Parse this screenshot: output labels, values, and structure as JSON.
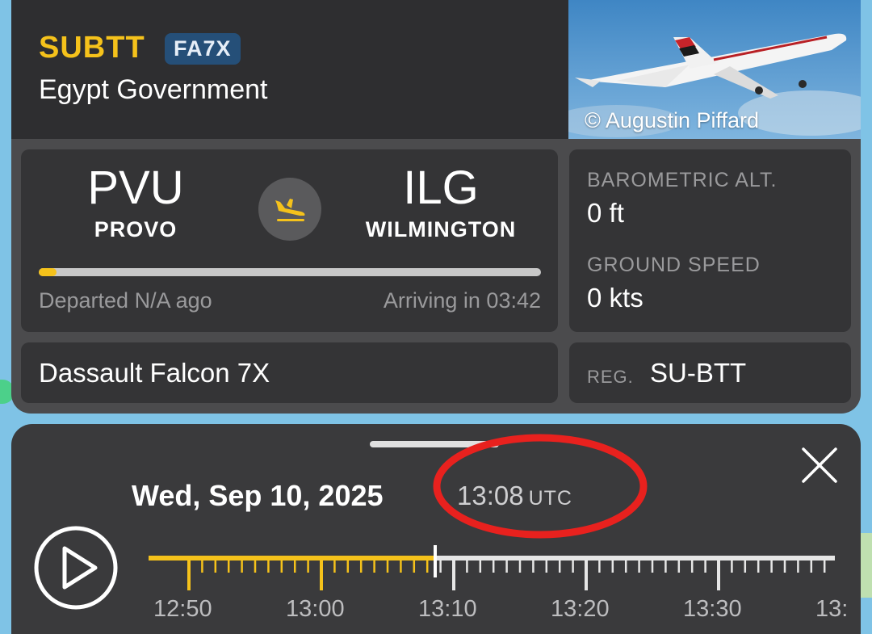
{
  "flight": {
    "callsign": "SUBTT",
    "aircraft_type_code": "FA7X",
    "operator": "Egypt Government",
    "photo_credit": "© Augustin Piffard",
    "origin": {
      "code": "PVU",
      "city": "PROVO"
    },
    "destination": {
      "code": "ILG",
      "city": "WILMINGTON"
    },
    "progress_fraction": 0.035,
    "departed_text": "Departed N/A ago",
    "arriving_text": "Arriving in 03:42",
    "stats": {
      "baro_alt_label": "BAROMETRIC ALT.",
      "baro_alt_value": "0 ft",
      "ground_speed_label": "GROUND SPEED",
      "ground_speed_value": "0 kts"
    },
    "aircraft_model": "Dassault Falcon 7X",
    "reg_label": "REG.",
    "reg_value": "SU-BTT"
  },
  "playback": {
    "date": "Wed, Sep 10, 2025",
    "time": "13:08",
    "timezone": "UTC",
    "tick_labels": [
      "12:50",
      "13:00",
      "13:10",
      "13:20",
      "13:30",
      "13:"
    ],
    "played_color": "#f5c21b",
    "remaining_color": "#e6e6e6"
  },
  "colors": {
    "accent": "#f5c21b",
    "badge": "#254f78",
    "annotation": "#e8211e"
  },
  "icons": {
    "arrival": "airplane-landing-icon",
    "play": "play-icon",
    "close": "close-icon"
  }
}
